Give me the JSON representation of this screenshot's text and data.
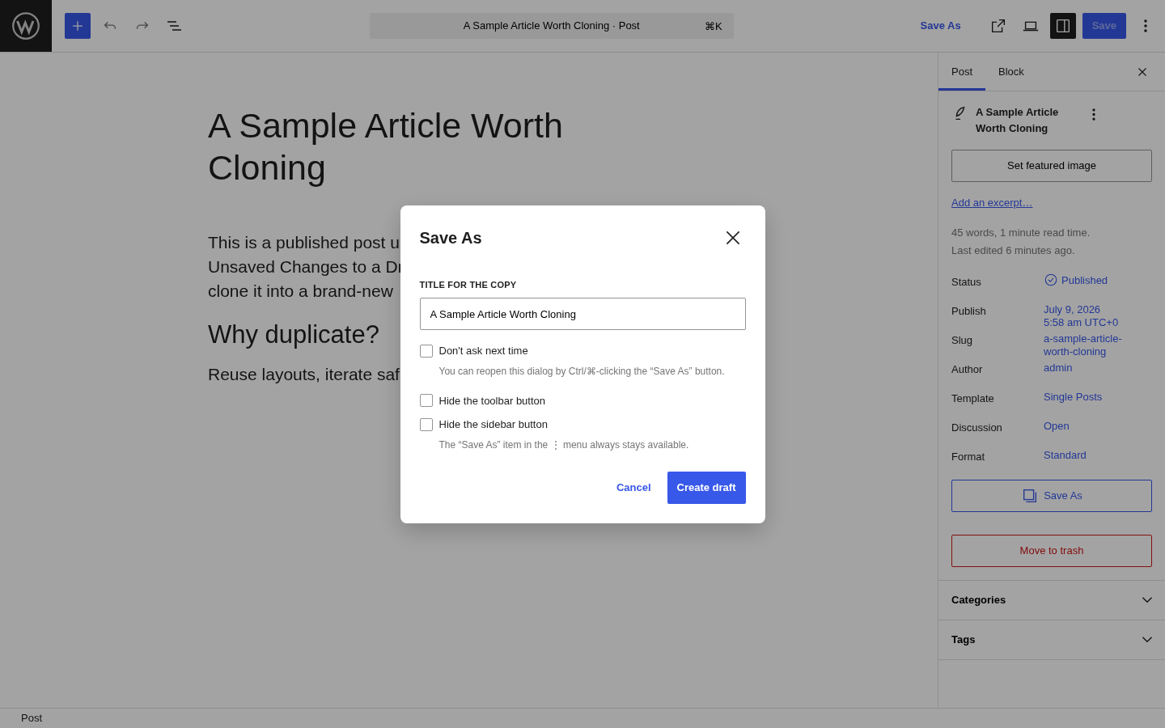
{
  "topbar": {
    "document_title": "A Sample Article Worth Cloning · Post",
    "shortcut": "⌘K",
    "save_as": "Save As",
    "save": {
      "label": "Save",
      "disabled": true
    },
    "sidebar_toggle_on": true
  },
  "editor": {
    "title": "A Sample Article Worth Cloning",
    "paragraph_lines": [
      "This is a published post u",
      "Unsaved Changes to a Dr",
      "clone it into a brand-new"
    ],
    "heading": "Why duplicate?",
    "paragraph2": "Reuse layouts, iterate saf"
  },
  "sidebar": {
    "tabs": [
      {
        "label": "Post",
        "selected": true
      },
      {
        "label": "Block",
        "selected": false
      }
    ],
    "post_title": "A Sample Article Worth Cloning",
    "featured_image": "Set featured image",
    "excerpt_link": "Add an excerpt…",
    "stats": [
      "45 words, 1 minute read time.",
      "Last edited 6 minutes ago."
    ],
    "fields": [
      {
        "label": "Status",
        "kind": "status",
        "value_lines": [
          "Published"
        ]
      },
      {
        "label": "Publish",
        "kind": "link",
        "value_lines": [
          "July 9, 2026",
          "5:58 am UTC+0"
        ]
      },
      {
        "label": "Slug",
        "kind": "link",
        "value_lines": [
          "a-sample-article-",
          "worth-cloning"
        ]
      },
      {
        "label": "Author",
        "kind": "link",
        "value_lines": [
          "admin"
        ]
      },
      {
        "label": "Template",
        "kind": "link",
        "value_lines": [
          "Single Posts"
        ]
      },
      {
        "label": "Discussion",
        "kind": "link",
        "value_lines": [
          "Open"
        ]
      },
      {
        "label": "Format",
        "kind": "link",
        "value_lines": [
          "Standard"
        ]
      }
    ],
    "save_as": "Save As",
    "trash": "Move to trash",
    "panels": [
      {
        "title": "Categories",
        "expanded": false
      },
      {
        "title": "Tags",
        "expanded": false
      }
    ]
  },
  "status_bar": "Post",
  "dialog": {
    "title": "Save As",
    "field_label": "TITLE FOR THE COPY",
    "field_value": "A Sample Article Worth Cloning",
    "options": [
      {
        "label": "Don't ask next time",
        "checked": false,
        "help": "You can reopen this dialog by Ctrl/⌘-clicking the “Save As” button."
      },
      {
        "label": "Hide the toolbar button",
        "checked": false
      },
      {
        "label": "Hide the sidebar button",
        "checked": false,
        "help": "The “Save As” item in the ⋮ menu always stays available."
      }
    ],
    "cancel": "Cancel",
    "confirm": "Create draft"
  }
}
